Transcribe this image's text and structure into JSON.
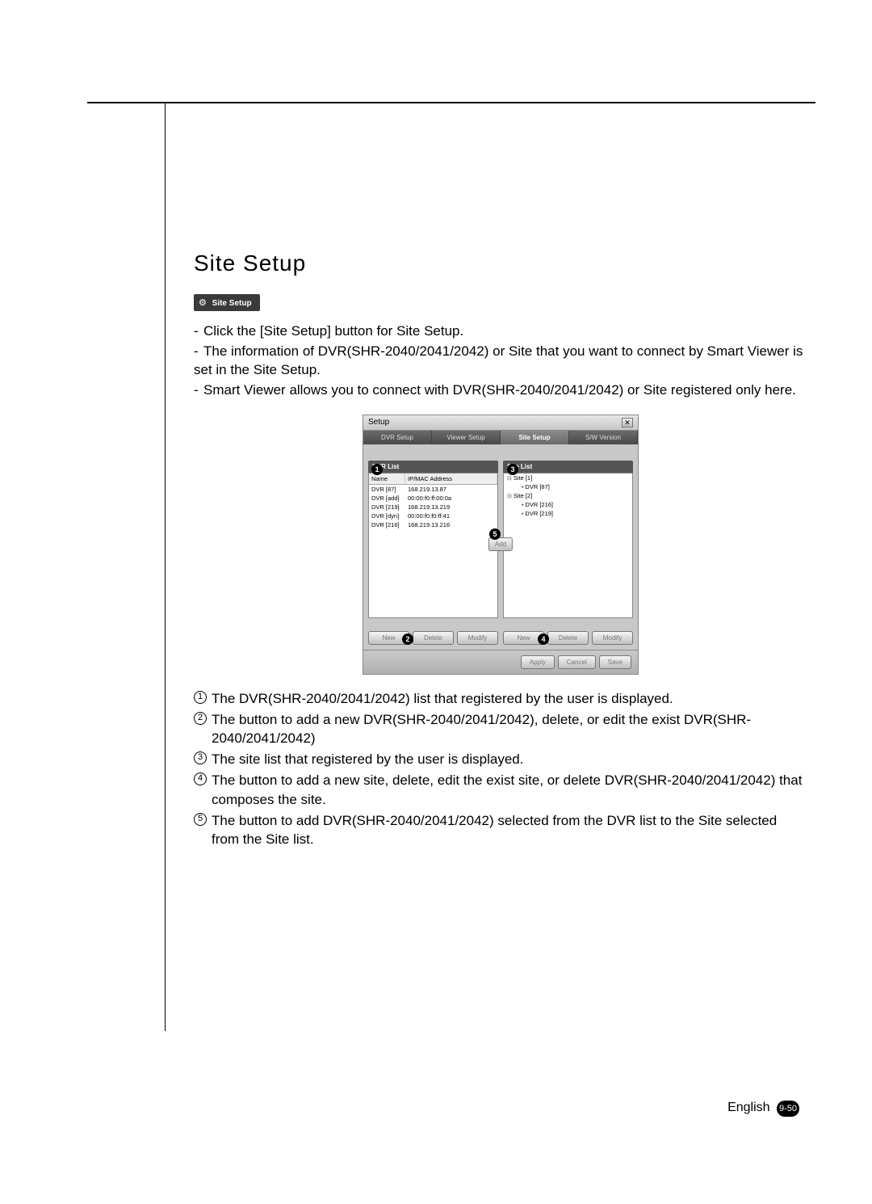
{
  "heading": "Site Setup",
  "site_setup_btn_label": "Site Setup",
  "bullets": [
    "Click the [Site Setup] button for Site Setup.",
    "The information of DVR(SHR-2040/2041/2042) or Site that you want to connect by Smart Viewer is set in the Site Setup.",
    "Smart Viewer allows you to connect with DVR(SHR-2040/2041/2042) or Site registered only here."
  ],
  "dialog": {
    "title": "Setup",
    "close_glyph": "✕",
    "tabs": [
      "DVR Setup",
      "Viewer Setup",
      "Site Setup",
      "S/W Version"
    ],
    "active_tab_index": 2,
    "dvr_list": {
      "title": "DVR List",
      "cols": [
        "Name",
        "IP/MAC Address"
      ],
      "rows": [
        {
          "name": "DVR [87]",
          "addr": "168.219.13.87"
        },
        {
          "name": "DVR [add]",
          "addr": "00:00:f0:ff:00:0a"
        },
        {
          "name": "DVR [219]",
          "addr": "168.219.13.219"
        },
        {
          "name": "DVR [dyn]",
          "addr": "00:00:f0:f0:ff:41"
        },
        {
          "name": "DVR [216]",
          "addr": "168.219.13.216"
        }
      ],
      "buttons": [
        "New",
        "Delete",
        "Modify"
      ]
    },
    "site_list": {
      "title": "Site List",
      "tree": [
        {
          "label": "Site [1]",
          "children": [
            "DVR [87]"
          ]
        },
        {
          "label": "Site [2]",
          "children": [
            "DVR [216]",
            "DVR [219]"
          ]
        }
      ],
      "buttons": [
        "New",
        "Delete",
        "Modify"
      ]
    },
    "add_button": "Add",
    "footer_buttons": [
      "Apply",
      "Cancel",
      "Save"
    ],
    "callouts": {
      "1": "1",
      "2": "2",
      "3": "3",
      "4": "4",
      "5": "5"
    }
  },
  "explanations": [
    "The DVR(SHR-2040/2041/2042) list that registered by the user is displayed.",
    "The button to add a new DVR(SHR-2040/2041/2042), delete, or edit the exist DVR(SHR-2040/2041/2042)",
    "The site list that registered by the user is displayed.",
    "The button to add a new site, delete, edit the exist site, or delete DVR(SHR-2040/2041/2042) that composes the site.",
    "The button to add DVR(SHR-2040/2041/2042) selected from the DVR list to the Site selected from the Site list."
  ],
  "footer": {
    "lang": "English",
    "page": "9-50"
  }
}
